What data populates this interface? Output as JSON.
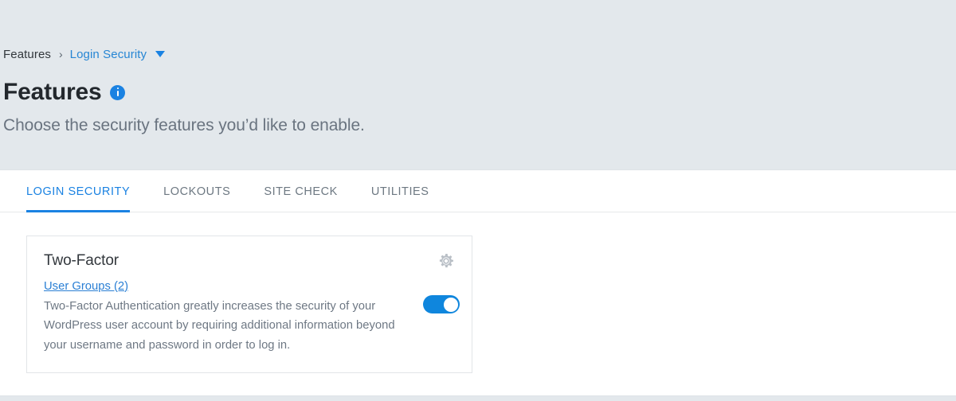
{
  "breadcrumb": {
    "root_label": "Features",
    "separator": "›",
    "current_label": "Login Security",
    "caret_icon": "chevron-down-icon"
  },
  "header": {
    "title": "Features",
    "info_icon": "info-icon",
    "subtitle": "Choose the security features you’d like to enable."
  },
  "tabs": [
    {
      "label": "LOGIN SECURITY",
      "active": true
    },
    {
      "label": "LOCKOUTS",
      "active": false
    },
    {
      "label": "SITE CHECK",
      "active": false
    },
    {
      "label": "UTILITIES",
      "active": false
    }
  ],
  "cards": [
    {
      "title": "Two-Factor",
      "link_label": "User Groups (2)",
      "description": "Two-Factor Authentication greatly increases the security of your WordPress user account by requiring additional information beyond your username and password in order to log in.",
      "settings_icon": "gear-icon",
      "toggle_state": "on"
    }
  ],
  "colors": {
    "page_background": "#e3e8ec",
    "accent_blue": "#1a82e2",
    "toggle_on": "#0f86dd",
    "link_blue": "#2a7fd4",
    "body_text": "#6e7884",
    "heading_text": "#23282d"
  }
}
